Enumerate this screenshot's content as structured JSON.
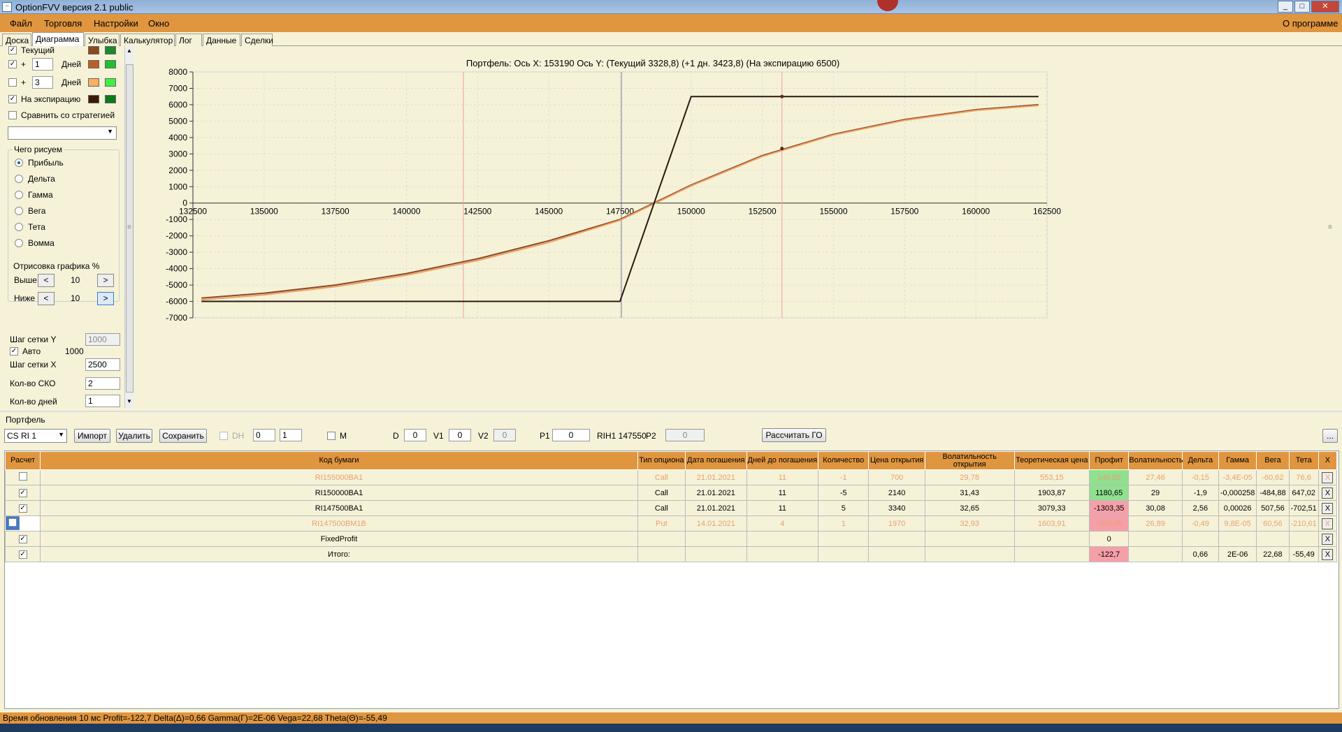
{
  "window": {
    "title": "OptionFVV версия 2.1 public"
  },
  "menu": {
    "file": "Файл",
    "trade": "Торговля",
    "settings": "Настройки",
    "window": "Окно",
    "about": "О программе"
  },
  "tabs": [
    "Доска",
    "Диаграмма",
    "Улыбка",
    "Калькулятор",
    "Лог",
    "Данные",
    "Сделки"
  ],
  "left": {
    "current": "Текущий",
    "plus": "+",
    "days_label": "Дней",
    "days1": "1",
    "days2": "3",
    "expiry": "На экспирацию",
    "compare": "Сравнить со стратегией",
    "draw_group": "Чего рисуем",
    "radios": [
      "Прибыль",
      "Дельта",
      "Гамма",
      "Вега",
      "Тета",
      "Вомма"
    ],
    "render_group": "Отрисовка графика %",
    "above": "Выше",
    "below": "Ниже",
    "above_val": "10",
    "below_val": "10",
    "left_arrow": "<",
    "right_arrow": ">",
    "grid_y": "Шаг сетки Y",
    "grid_y_val": "1000",
    "auto": "Авто",
    "auto_val": "1000",
    "grid_x": "Шаг сетки X",
    "grid_x_val": "2500",
    "sko": "Кол-во СКО",
    "sko_val": "2",
    "days_count": "Кол-во дней",
    "days_count_val": "1"
  },
  "chart_data": {
    "type": "line",
    "title": "Портфель: Ось X: 153190 Ось Y:  (Текущий 3328,8)  (+1 дн. 3423,8)  (На экспирацию 6500)",
    "xlim": [
      132500,
      162500
    ],
    "ylim": [
      -7000,
      8000
    ],
    "xticks": [
      132500,
      135000,
      137500,
      140000,
      142500,
      145000,
      147500,
      150000,
      152500,
      155000,
      157500,
      160000,
      162500
    ],
    "yticks": [
      8000,
      7000,
      6000,
      5000,
      4000,
      3000,
      2000,
      1000,
      0,
      -1000,
      -2000,
      -3000,
      -4000,
      -5000,
      -6000,
      -7000
    ],
    "vlines": [
      {
        "x": 142000,
        "color": "#f0a0a0"
      },
      {
        "x": 147550,
        "color": "#7a7a9a"
      },
      {
        "x": 153190,
        "color": "#f0a0a0"
      }
    ],
    "series": [
      {
        "color": "#8a4a2a",
        "x": [
          132800,
          135000,
          137500,
          140000,
          142500,
          145000,
          147500,
          150000,
          152500,
          155000,
          157500,
          160000,
          162200
        ],
        "y": [
          -5800,
          -5500,
          -5000,
          -4300,
          -3400,
          -2300,
          -1000,
          1100,
          2900,
          4200,
          5100,
          5700,
          6000
        ]
      },
      {
        "color": "#f0a060",
        "x": [
          132800,
          135000,
          137500,
          140000,
          142500,
          145000,
          147500,
          150000,
          152500,
          155000,
          157500,
          160000,
          162200
        ],
        "y": [
          -5900,
          -5600,
          -5100,
          -4400,
          -3500,
          -2400,
          -1050,
          1050,
          2850,
          4150,
          5050,
          5650,
          5950
        ]
      },
      {
        "color": "#2a1a10",
        "x": [
          132800,
          147500,
          150000,
          162200
        ],
        "y": [
          -6000,
          -6000,
          6500,
          6500
        ]
      }
    ],
    "points": [
      {
        "x": 153190,
        "y": 6500
      },
      {
        "x": 153190,
        "y": 3328.8
      }
    ]
  },
  "portfolio": {
    "label": "Портфель",
    "select": "CS RI 1",
    "import": "Импорт",
    "delete": "Удалить",
    "save": "Сохранить",
    "dh": "DH",
    "dh1": "0",
    "dh2": "1",
    "m": "M",
    "d": "D",
    "d_val": "0",
    "v1": "V1",
    "v1_val": "0",
    "v2": "V2",
    "v2_val": "0",
    "p1": "P1",
    "p1_val": "0",
    "rih": "RIH1 147550",
    "p2": "P2",
    "p2_val": "0",
    "calc_go": "Рассчитать ГО",
    "ellipsis": "..."
  },
  "table": {
    "headers": [
      "Расчет",
      "Код бумаги",
      "Тип опциона",
      "Дата погашения",
      "Дней до погашения",
      "Количество",
      "Цена открытия",
      "Волатильность открытия",
      "Теоретическая цена",
      "Профит",
      "Волатильность",
      "Дельта",
      "Гамма",
      "Вега",
      "Тета",
      "X"
    ],
    "rows": [
      {
        "dim": true,
        "check": "",
        "cells": [
          "RI155000BA1",
          "Call",
          "21.01.2021",
          "11",
          "-1",
          "700",
          "29,78",
          "553,15",
          "146,85",
          "27,46",
          "-0,15",
          "-3,4E-05",
          "-60,62",
          "76,6"
        ],
        "profit_class": "pg"
      },
      {
        "dim": false,
        "check": "✓",
        "cells": [
          "RI150000BA1",
          "Call",
          "21.01.2021",
          "11",
          "-5",
          "2140",
          "31,43",
          "1903,87",
          "1180,65",
          "29",
          "-1,9",
          "-0,000258",
          "-484,88",
          "647,02"
        ],
        "profit_class": "pg"
      },
      {
        "dim": false,
        "check": "✓",
        "cells": [
          "RI147500BA1",
          "Call",
          "21.01.2021",
          "11",
          "5",
          "3340",
          "32,65",
          "3079,33",
          "-1303,35",
          "30,08",
          "2,56",
          "0,00026",
          "507,56",
          "-702,51"
        ],
        "profit_class": "pr"
      },
      {
        "dim": true,
        "sel": true,
        "check": "",
        "cells": [
          "RI147500BM1B",
          "Put",
          "14.01.2021",
          "4",
          "1",
          "1970",
          "32,93",
          "1603,91",
          "-366,09",
          "26,89",
          "-0,49",
          "9,8E-05",
          "60,56",
          "-210,61"
        ],
        "profit_class": "pr"
      },
      {
        "dim": false,
        "check": "✓",
        "cells": [
          "FixedProfit",
          "",
          "",
          "",
          "",
          "",
          "",
          "",
          "0",
          "",
          "",
          "",
          "",
          ""
        ],
        "profit_class": ""
      },
      {
        "dim": false,
        "check": "✓",
        "cells": [
          "Итого:",
          "",
          "",
          "",
          "",
          "",
          "",
          "",
          "-122,7",
          "",
          "0,66",
          "2E-06",
          "22,68",
          "-55,49"
        ],
        "profit_class": "pr"
      }
    ],
    "x_label": "X"
  },
  "status": "Время обновления 10 мс  Profit=-122,7 Delta(Δ)=0,66 Gamma(Γ)=2E-06 Vega=22,68 Theta(Θ)=-55,49"
}
